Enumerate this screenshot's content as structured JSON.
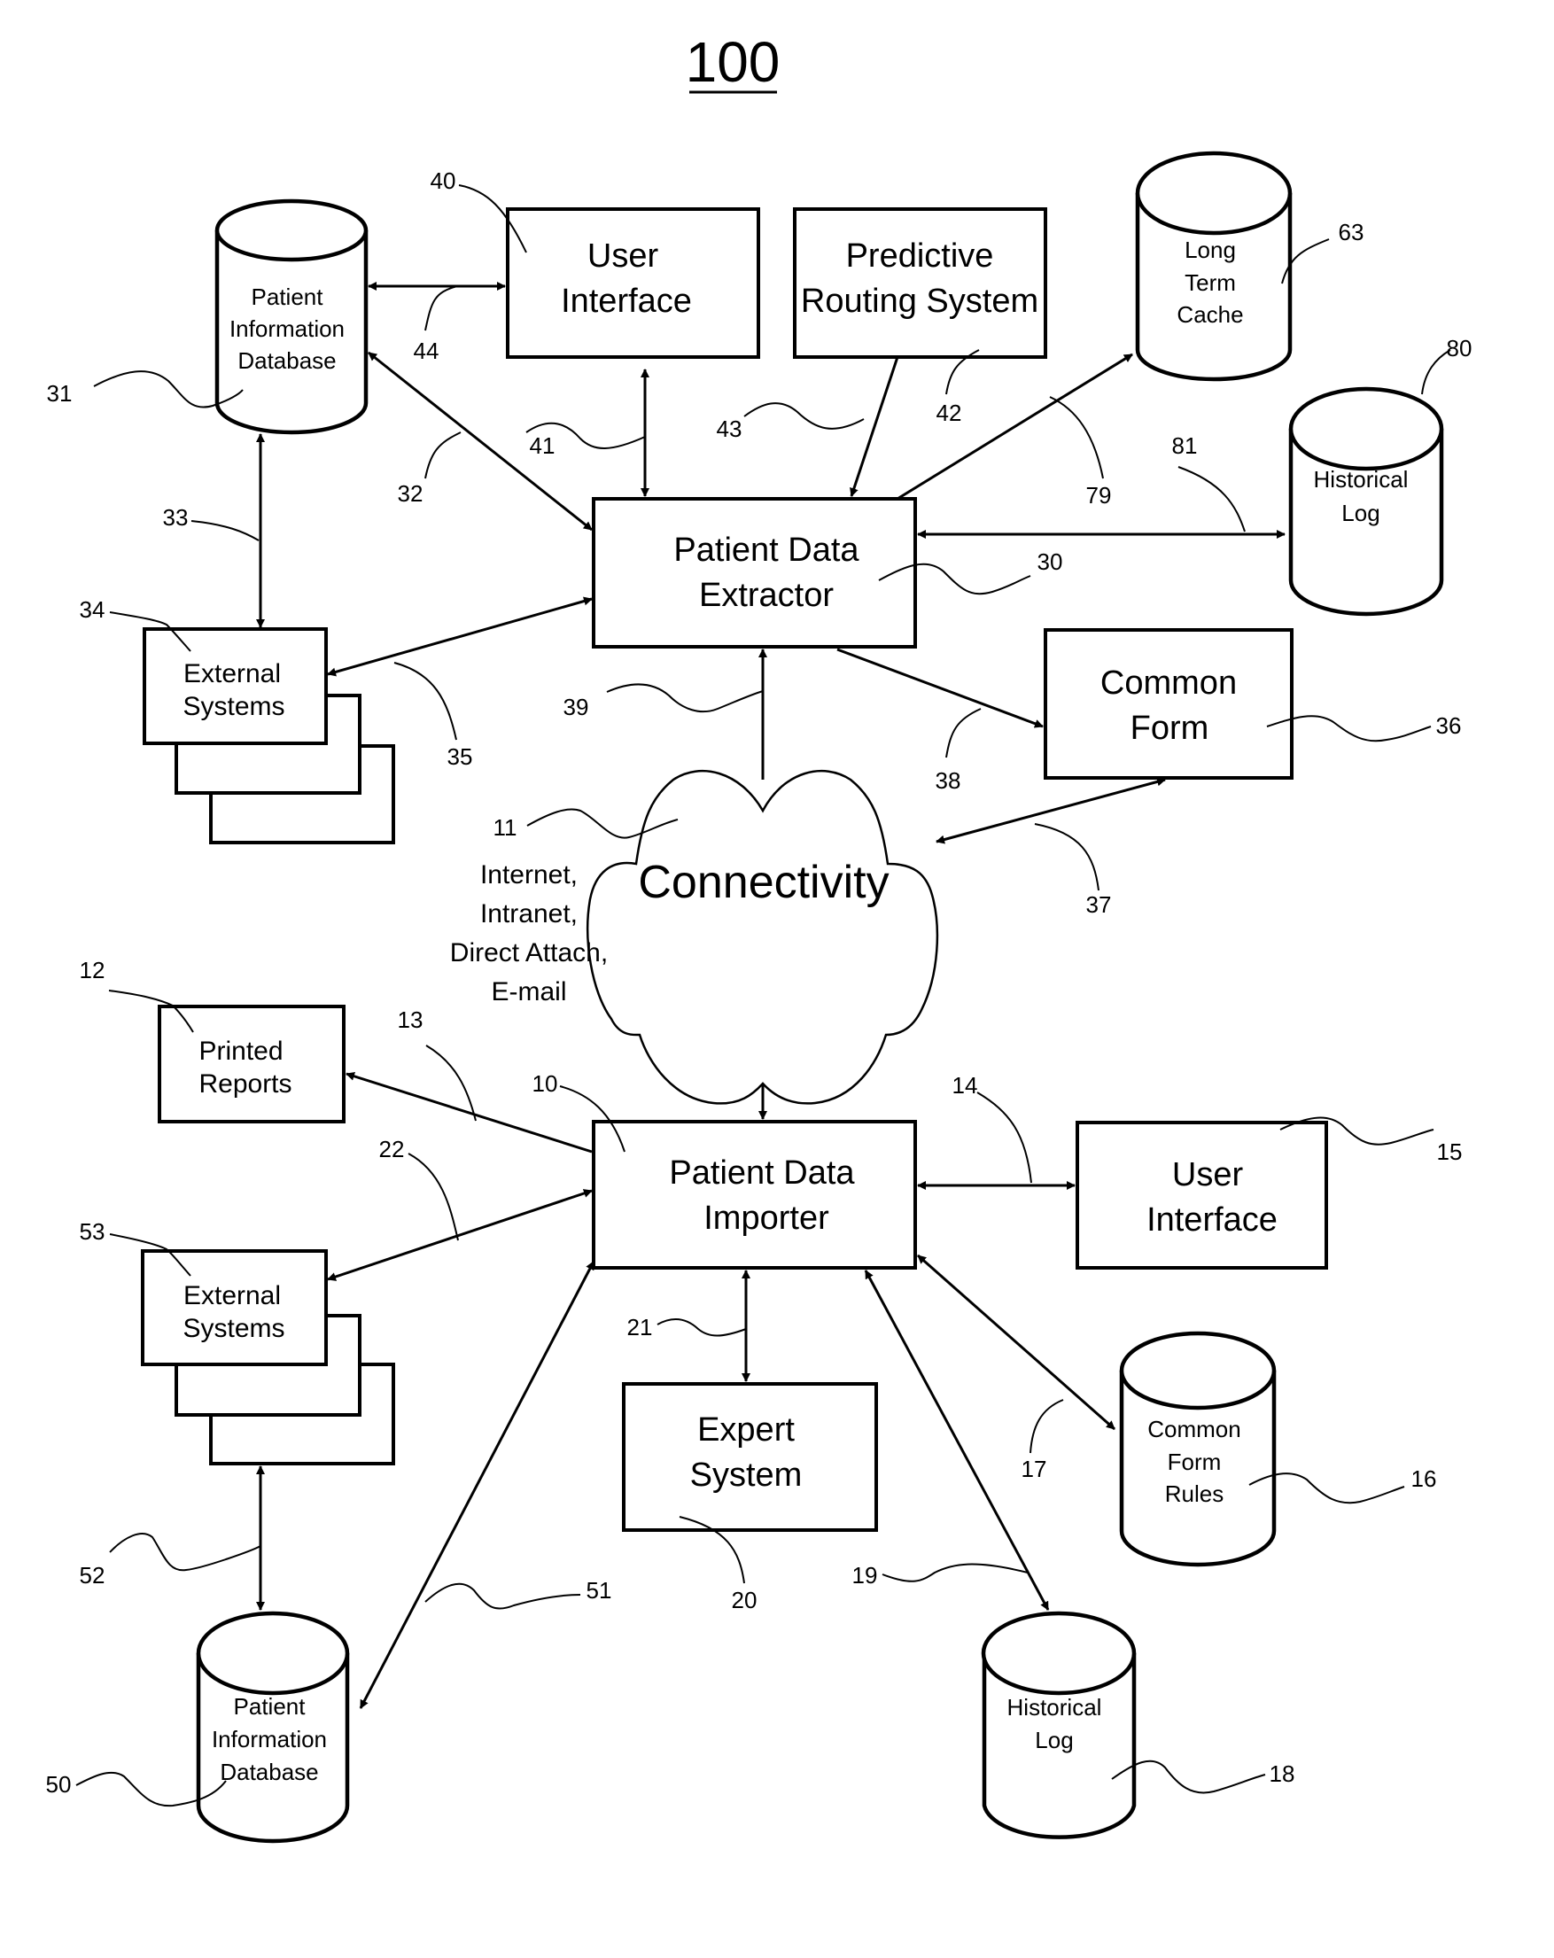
{
  "figure": {
    "number": "100",
    "components": {
      "patient_info_db_top": {
        "ref": "31",
        "lines": [
          "Patient",
          "Information",
          "Database"
        ]
      },
      "user_interface_top": {
        "ref": "40",
        "lines": [
          "User",
          "Interface"
        ]
      },
      "predictive_routing": {
        "ref": "42",
        "lines": [
          "Predictive",
          "Routing System"
        ]
      },
      "long_term_cache": {
        "ref": "63",
        "lines": [
          "Long",
          "Term",
          "Cache"
        ]
      },
      "historical_log_top": {
        "ref": "80",
        "lines": [
          "Historical",
          "Log"
        ]
      },
      "patient_data_extractor": {
        "ref": "30",
        "lines": [
          "Patient Data",
          "Extractor"
        ]
      },
      "external_systems_top": {
        "ref": "34",
        "lines": [
          "External",
          "Systems"
        ]
      },
      "common_form": {
        "ref": "36",
        "lines": [
          "Common",
          "Form"
        ]
      },
      "connectivity": {
        "ref": "11",
        "label": "Connectivity",
        "notes": [
          "Internet,",
          "Intranet,",
          "Direct Attach,",
          "E-mail"
        ]
      },
      "printed_reports": {
        "ref": "12",
        "lines": [
          "Printed",
          "Reports"
        ]
      },
      "patient_data_importer": {
        "ref": "10",
        "lines": [
          "Patient Data",
          "Importer"
        ]
      },
      "user_interface_bottom": {
        "ref": "15",
        "lines": [
          "User",
          "Interface"
        ]
      },
      "external_systems_bottom": {
        "ref": "53",
        "lines": [
          "External",
          "Systems"
        ]
      },
      "expert_system": {
        "ref": "20",
        "lines": [
          "Expert",
          "System"
        ]
      },
      "common_form_rules": {
        "ref": "16",
        "lines": [
          "Common",
          "Form",
          "Rules"
        ]
      },
      "patient_info_db_bottom": {
        "ref": "50",
        "lines": [
          "Patient",
          "Information",
          "Database"
        ]
      },
      "historical_log_bottom": {
        "ref": "18",
        "lines": [
          "Historical",
          "Log"
        ]
      }
    },
    "connections": {
      "c44": "44",
      "c32": "32",
      "c41": "41",
      "c43": "43",
      "c79": "79",
      "c81": "81",
      "c33": "33",
      "c35": "35",
      "c39": "39",
      "c38": "38",
      "c37": "37",
      "c13": "13",
      "c22": "22",
      "c14": "14",
      "c21": "21",
      "c17": "17",
      "c19": "19",
      "c51": "51",
      "c52": "52"
    }
  }
}
